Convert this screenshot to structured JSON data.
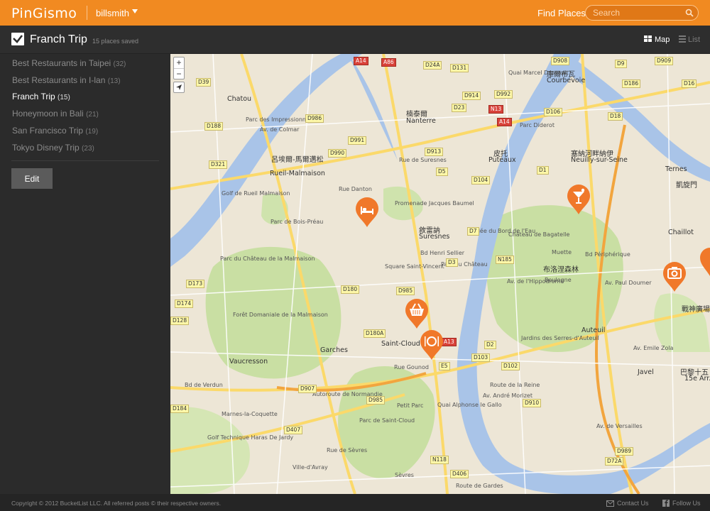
{
  "app": {
    "logo": "PinGismo",
    "username": "billsmith",
    "find_places": "Find Places",
    "search_placeholder": "Search"
  },
  "trip": {
    "title": "Franch Trip",
    "saved": "15 places saved"
  },
  "view_toggle": {
    "map": "Map",
    "list": "List"
  },
  "sidebar": {
    "trips": [
      {
        "name": "Best Restaurants in Taipei",
        "count": "(32)"
      },
      {
        "name": "Best Restaurants in I-lan",
        "count": "(13)"
      },
      {
        "name": "Franch Trip",
        "count": "(15)"
      },
      {
        "name": "Honeymoon in Bali",
        "count": "(21)"
      },
      {
        "name": "San Francisco Trip",
        "count": "(19)"
      },
      {
        "name": "Tokyo Disney Trip",
        "count": "(23)"
      }
    ],
    "edit_label": "Edit"
  },
  "map": {
    "zoom_in": "+",
    "zoom_out": "−",
    "places": [
      "Chatou",
      "Nanterre",
      "Suresnes",
      "Puteaux",
      "Courbevoie",
      "Neuilly-sur-Seine",
      "Rueil-Malmaison",
      "Saint-Cloud",
      "Garches",
      "Vaucresson",
      "Sèvres",
      "Ville-d'Avray",
      "Boulogne",
      "Auteuil",
      "Chaillot",
      "Javel",
      "15e Arr.",
      "Muette",
      "Ternes"
    ],
    "cjk": [
      "楠泰爾",
      "庫爾布瓦",
      "皮托",
      "塞納河畔納伊",
      "呂埃爾-馬爾邁松",
      "敘雷訥",
      "布洛涅森林",
      "巴黎十五",
      "戰神廣場",
      "凱旋門"
    ],
    "streets": [
      "Av. de Colmar",
      "Rue Danton",
      "Rue de Suresnes",
      "Promenade Jacques Baumel",
      "Square Saint-Vincent",
      "Bd Henri Sellier",
      "Parc du Château",
      "Château de Bagatelle",
      "Allée du Bord de l'Eau",
      "Av. de l'Hippodrome",
      "Bd Périphérique",
      "Av. Paul Doumer",
      "Av. Emile Zola",
      "Route de la Reine",
      "Autoroute de Normandie",
      "Rue Gounod",
      "Quai Alphonse le Gallo",
      "Av. André Morizet",
      "Parc de Saint-Cloud",
      "Forêt Domaniale de la Malmaison",
      "Golf de Rueil Malmaison",
      "Parc de Bois-Préau",
      "Golf Technique Haras De Jardy",
      "Marnes-la-Coquette",
      "Petit Parc",
      "Rue de Sèvres",
      "Quai Marcel Dassault",
      "Bd de Verdun",
      "Jardins des Serres-d'Auteuil",
      "Parc des Impressionnistes",
      "Parc Diderot",
      "Av. de Versailles",
      "Route de Gardes",
      "Parc du Château de la Malmaison"
    ],
    "routes": [
      "A14",
      "A86",
      "D24A",
      "D131",
      "D914",
      "D992",
      "D908",
      "D909",
      "D9",
      "D39",
      "D986",
      "D991",
      "D990",
      "D913",
      "D23",
      "D106",
      "N13",
      "A14",
      "D1",
      "D7",
      "D104",
      "D5",
      "D3",
      "D985",
      "D180",
      "D180A",
      "D173",
      "D174",
      "D128",
      "A13",
      "E5",
      "D2",
      "D103",
      "D102",
      "D907",
      "D985",
      "D407",
      "N118",
      "D406",
      "D910",
      "D989",
      "D72A",
      "D321",
      "D188",
      "D184",
      "D186",
      "D16",
      "D18",
      "N185"
    ]
  },
  "footer": {
    "copyright": "Copyright © 2012 BucketList LLC. All referred posts © their respective owners.",
    "contact": "Contact Us",
    "follow": "Follow Us"
  }
}
